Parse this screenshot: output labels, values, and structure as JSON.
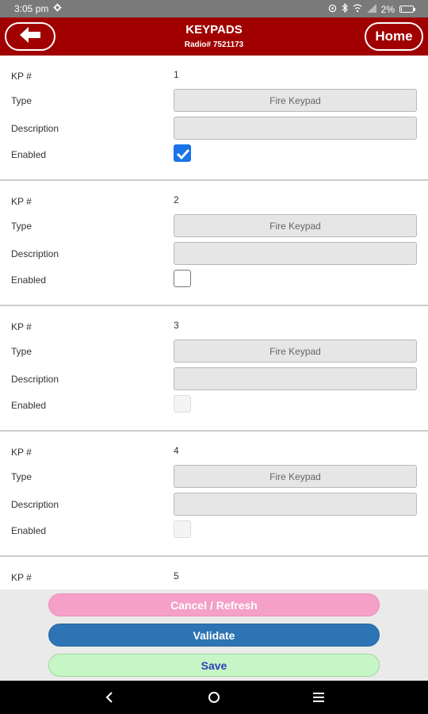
{
  "status_bar": {
    "time": "3:05 pm",
    "battery": "2%",
    "battery_level": 0.02,
    "icons": [
      "gear-icon",
      "sync-icon",
      "bluetooth-icon",
      "wifi-icon",
      "signal-icon",
      "battery-icon"
    ]
  },
  "header": {
    "title": "KEYPADS",
    "subtitle": "Radio# 7521173",
    "home_label": "Home",
    "back_icon": "arrow-left-icon"
  },
  "labels": {
    "kp": "KP #",
    "type": "Type",
    "description": "Description",
    "enabled": "Enabled"
  },
  "keypads": [
    {
      "number": "1",
      "type": "Fire Keypad",
      "description": "",
      "enabled": "checked"
    },
    {
      "number": "2",
      "type": "Fire Keypad",
      "description": "",
      "enabled": "unchecked"
    },
    {
      "number": "3",
      "type": "Fire Keypad",
      "description": "",
      "enabled": "disabled"
    },
    {
      "number": "4",
      "type": "Fire Keypad",
      "description": "",
      "enabled": "disabled"
    },
    {
      "number": "5"
    }
  ],
  "buttons": {
    "cancel": "Cancel / Refresh",
    "validate": "Validate",
    "save": "Save"
  },
  "nav": {
    "back_icon": "nav-back-icon",
    "home_icon": "nav-home-icon",
    "menu_icon": "nav-menu-icon"
  },
  "colors": {
    "header": "#a00000",
    "cancel_button": "#f4a0c8",
    "validate_button": "#2d74b4",
    "save_button": "#c6f5c6",
    "checkbox_checked": "#1a73e8"
  }
}
